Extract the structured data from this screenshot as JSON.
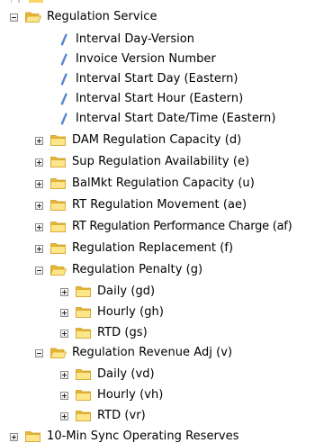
{
  "tree": {
    "root": {
      "label": "Regulation Service",
      "icon": "open-folder-icon",
      "expanded": true
    },
    "fields": [
      "Interval Day-Version",
      "Invoice Version Number",
      "Interval Start Day (Eastern)",
      "Interval Start Hour (Eastern)",
      "Interval Start Date/Time (Eastern)"
    ],
    "folders": [
      {
        "label": "DAM Regulation Capacity (d)",
        "expanded": false
      },
      {
        "label": "Sup Regulation Availability (e)",
        "expanded": false
      },
      {
        "label": "BalMkt Regulation Capacity (u)",
        "expanded": false
      },
      {
        "label": "RT Regulation Movement (ae)",
        "expanded": false
      },
      {
        "label": "RT Regulation Performance Charge (af)",
        "expanded": false
      },
      {
        "label": "Regulation Replacement (f)",
        "expanded": false
      },
      {
        "label": "Regulation Penalty (g)",
        "expanded": true,
        "children": [
          {
            "label": "Daily (gd)",
            "expanded": false
          },
          {
            "label": "Hourly (gh)",
            "expanded": false
          },
          {
            "label": "RTD (gs)",
            "expanded": false
          }
        ]
      },
      {
        "label": "Regulation Revenue Adj (v)",
        "expanded": true,
        "children": [
          {
            "label": "Daily (vd)",
            "expanded": false
          },
          {
            "label": "Hourly (vh)",
            "expanded": false
          },
          {
            "label": "RTD (vr)",
            "expanded": false
          }
        ]
      }
    ],
    "next_sibling": {
      "label": "10-Min Sync Operating Reserves",
      "expanded": false
    }
  },
  "colors": {
    "folder_light": "#fde68a",
    "folder_dark": "#e8b737",
    "field_icon": "#5b8fd6"
  }
}
